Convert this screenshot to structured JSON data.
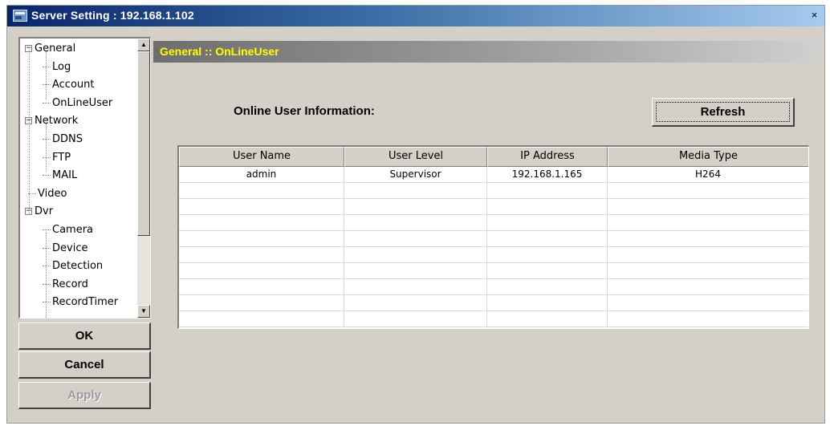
{
  "window": {
    "title": "Server Setting : 192.168.1.102",
    "close_glyph": "×"
  },
  "tree": {
    "items": [
      {
        "label": "General",
        "level": 0,
        "expander": "−"
      },
      {
        "label": "Log",
        "level": 1
      },
      {
        "label": "Account",
        "level": 1
      },
      {
        "label": "OnLineUser",
        "level": 1
      },
      {
        "label": "Network",
        "level": 0,
        "expander": "−"
      },
      {
        "label": "DDNS",
        "level": 1
      },
      {
        "label": "FTP",
        "level": 1
      },
      {
        "label": "MAIL",
        "level": 1
      },
      {
        "label": "Video",
        "level": 0
      },
      {
        "label": "Dvr",
        "level": 0,
        "expander": "−"
      },
      {
        "label": "Camera",
        "level": 1
      },
      {
        "label": "Device",
        "level": 1
      },
      {
        "label": "Detection",
        "level": 1
      },
      {
        "label": "Record",
        "level": 1
      },
      {
        "label": "RecordTimer",
        "level": 1
      }
    ],
    "scroll_up_glyph": "▲",
    "scroll_down_glyph": "▼"
  },
  "buttons": {
    "ok": "OK",
    "cancel": "Cancel",
    "apply": "Apply",
    "refresh": "Refresh"
  },
  "section": {
    "header": "General :: OnLineUser",
    "info_label": "Online User Information:"
  },
  "table": {
    "columns": [
      "User Name",
      "User Level",
      "IP Address",
      "Media Type"
    ],
    "rows": [
      [
        "admin",
        "Supervisor",
        "192.168.1.165",
        "H264"
      ],
      [
        "",
        "",
        "",
        ""
      ],
      [
        "",
        "",
        "",
        ""
      ],
      [
        "",
        "",
        "",
        ""
      ],
      [
        "",
        "",
        "",
        ""
      ],
      [
        "",
        "",
        "",
        ""
      ],
      [
        "",
        "",
        "",
        ""
      ],
      [
        "",
        "",
        "",
        ""
      ],
      [
        "",
        "",
        "",
        ""
      ],
      [
        "",
        "",
        "",
        ""
      ]
    ]
  },
  "colors": {
    "title_start": "#0a246a",
    "title_end": "#a6caf0",
    "header_text": "#ffff00",
    "dialog_face": "#d4d0c8"
  }
}
